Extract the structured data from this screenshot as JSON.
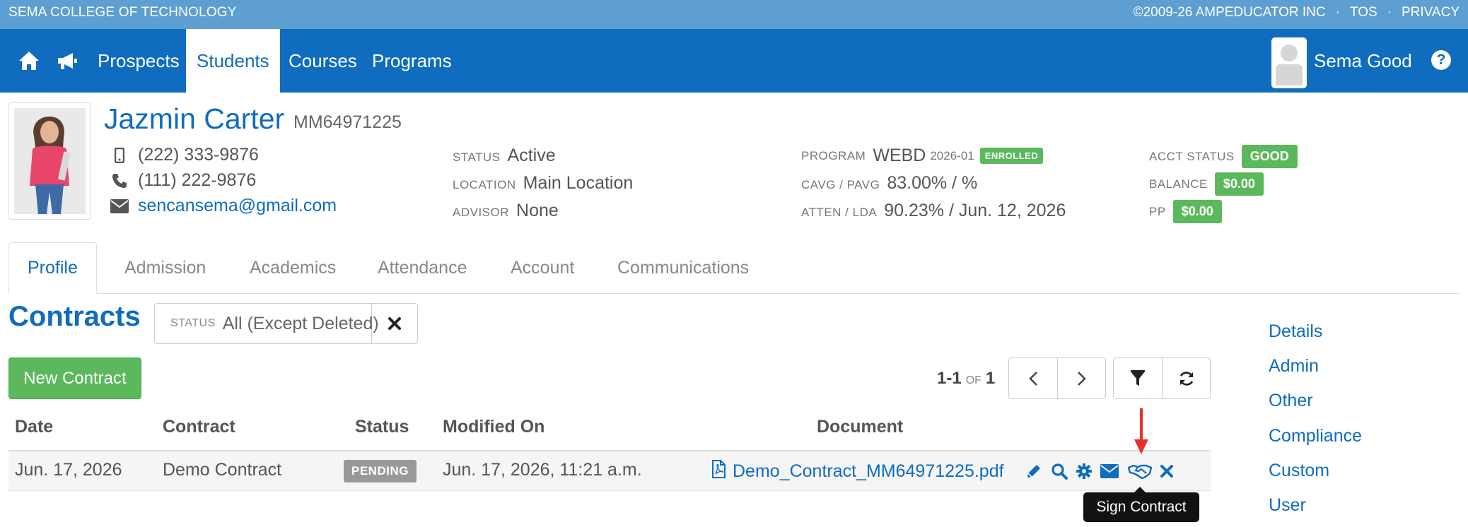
{
  "top_strip": {
    "college": "SEMA COLLEGE OF TECHNOLOGY",
    "copyright": "©2009-26 AMPEDUCATOR INC",
    "separator": "·",
    "tos": "TOS",
    "privacy": "PRIVACY"
  },
  "nav": {
    "items": [
      "Prospects",
      "Students",
      "Courses",
      "Programs"
    ],
    "active": "Students",
    "user_name": "Sema Good",
    "help_glyph": "?"
  },
  "student": {
    "name": "Jazmin Carter",
    "id": "MM64971225",
    "mobile": "(222) 333-9876",
    "phone": "(111) 222-9876",
    "email": "sencansema@gmail.com",
    "status_label": "STATUS",
    "status": "Active",
    "location_label": "LOCATION",
    "location": "Main Location",
    "advisor_label": "ADVISOR",
    "advisor": "None",
    "program_label": "PROGRAM",
    "program": "WEBD",
    "program_term": "2026-01",
    "program_badge": "ENROLLED",
    "cavg_label": "CAVG / PAVG",
    "cavg": "83.00% / %",
    "atten_label": "ATTEN / LDA",
    "atten": "90.23% / Jun. 12, 2026",
    "acct_status_label": "ACCT STATUS",
    "acct_status": "GOOD",
    "balance_label": "BALANCE",
    "balance": "$0.00",
    "pp_label": "PP",
    "pp": "$0.00"
  },
  "tabs": [
    "Profile",
    "Admission",
    "Academics",
    "Attendance",
    "Account",
    "Communications"
  ],
  "contracts": {
    "title": "Contracts",
    "filter_label": "STATUS",
    "filter_value": "All (Except Deleted)",
    "new_button": "New Contract",
    "pager_range": "1-1",
    "pager_of": "OF",
    "pager_total": "1",
    "columns": [
      "Date",
      "Contract",
      "Status",
      "Modified On",
      "Document"
    ],
    "rows": [
      {
        "date": "Jun. 17, 2026",
        "contract": "Demo Contract",
        "status": "PENDING",
        "modified": "Jun. 17, 2026, 11:21 a.m.",
        "document": "Demo_Contract_MM64971225.pdf"
      }
    ],
    "tooltip": "Sign Contract"
  },
  "side_links": [
    "Details",
    "Admin",
    "Other",
    "Compliance",
    "Custom",
    "User"
  ],
  "colors": {
    "primary": "#0f6cbf",
    "top_strip": "#5e9fd2",
    "success": "#5cb85c",
    "pending": "#999999",
    "arrow": "#e8312a"
  },
  "icons": [
    "home-icon",
    "megaphone-icon",
    "help-icon",
    "mobile-icon",
    "phone-icon",
    "envelope-icon",
    "close-icon",
    "chevron-left-icon",
    "chevron-right-icon",
    "filter-icon",
    "refresh-icon",
    "pdf-file-icon",
    "pencil-icon",
    "search-icon",
    "gear-icon",
    "envelope-icon",
    "handshake-icon",
    "delete-icon"
  ]
}
